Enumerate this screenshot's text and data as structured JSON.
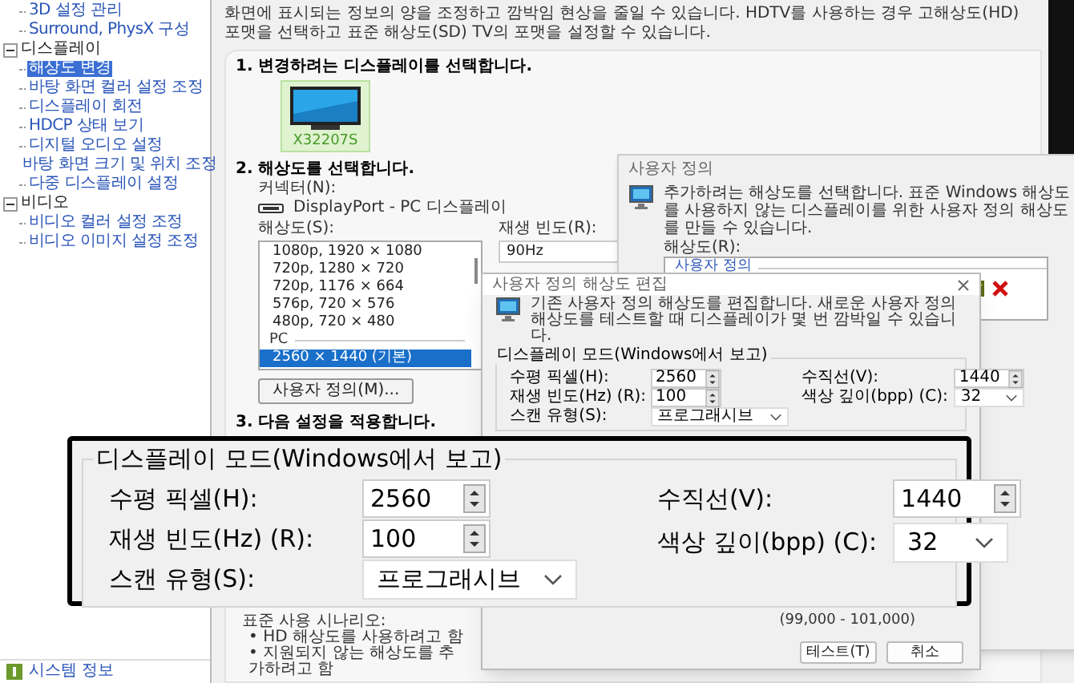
{
  "sidebar": {
    "groups": [
      {
        "children": [
          {
            "label": "3D 설정 관리",
            "selected": false
          },
          {
            "label": "Surround, PhysX 구성",
            "selected": false
          }
        ]
      },
      {
        "label": "디스플레이",
        "expanded": true,
        "children": [
          {
            "label": "해상도 변경",
            "selected": true
          },
          {
            "label": "바탕 화면 컬러 설정 조정",
            "selected": false
          },
          {
            "label": "디스플레이 회전",
            "selected": false
          },
          {
            "label": "HDCP 상태 보기",
            "selected": false
          },
          {
            "label": "디지털 오디오 설정",
            "selected": false
          },
          {
            "label": "바탕 화면 크기 및 위치 조정",
            "selected": false
          },
          {
            "label": "다중 디스플레이 설정",
            "selected": false
          }
        ]
      },
      {
        "label": "비디오",
        "expanded": true,
        "children": [
          {
            "label": "비디오 컬러 설정 조정",
            "selected": false
          },
          {
            "label": "비디오 이미지 설정 조정",
            "selected": false
          }
        ]
      }
    ],
    "footer": "시스템 정보"
  },
  "main": {
    "description": "화면에 표시되는 정보의 양을 조정하고 깜박임 현상을 줄일 수 있습니다. HDTV를 사용하는 경우 고해상도(HD) 포맷을 선택하고 표준 해상도(SD) TV의 포맷을 설정할 수 있습니다.",
    "step1": {
      "title": "1. 변경하려는 디스플레이를 선택합니다.",
      "displays": [
        {
          "name": "X32207S",
          "selected": true
        }
      ]
    },
    "step2": {
      "title": "2. 해상도를 선택합니다.",
      "connector_label": "커넥터(N):",
      "connector": "DisplayPort - PC 디스플레이",
      "resolution_label": "해상도(S):",
      "resolutions": [
        {
          "kind": "item",
          "label": "1080p, 1920 × 1080",
          "selected": false
        },
        {
          "kind": "item",
          "label": "720p, 1280 × 720",
          "selected": false
        },
        {
          "kind": "item",
          "label": "720p, 1176 × 664",
          "selected": false
        },
        {
          "kind": "item",
          "label": "576p, 720 × 576",
          "selected": false
        },
        {
          "kind": "item",
          "label": "480p, 720 × 480",
          "selected": false
        },
        {
          "kind": "group",
          "label": "PC",
          "selected": false
        },
        {
          "kind": "item",
          "label": "2560 × 1440 (기본)",
          "selected": true
        }
      ],
      "refresh_label": "재생 빈도(R):",
      "refresh_rate": "90Hz",
      "custom_button": "사용자 정의(M)..."
    },
    "step3": {
      "title": "3. 다음 설정을 적용합니다."
    },
    "scenarios": {
      "title": "표준 사용 시나리오:",
      "items": [
        "• HD 해상도를 사용하려고 함",
        "• 지원되지 않는 해상도를 추가하려고 함"
      ]
    }
  },
  "custom_dialog": {
    "title": "사용자 정의",
    "info": "추가하려는 해상도를 선택합니다. 표준 Windows 해상도를 사용하지 않는 디스플레이를 위한 사용자 정의 해상도를 만들 수 있습니다.",
    "resolution_label": "해상도(R):",
    "list_group": "사용자 정의"
  },
  "edit_dialog": {
    "title": "사용자 정의 해상도 편집",
    "info": "기존 사용자 정의 해상도를 편집합니다. 새로운 사용자 정의 해상도를 테스트할 때 디스플레이가 몇 번 깜박일 수 있습니다.",
    "group_title": "디스플레이 모드(Windows에서 보고)",
    "left_fields": [
      {
        "label": "수평 픽셀(H):",
        "value": "2560",
        "kind": "spin"
      },
      {
        "label": "재생 빈도(Hz) (R):",
        "value": "100",
        "kind": "spin"
      },
      {
        "label": "스캔 유형(S):",
        "value": "프로그래시브",
        "kind": "dropdown"
      }
    ],
    "right_fields": [
      {
        "label": "수직선(V):",
        "value": "1440",
        "kind": "spin"
      },
      {
        "label": "색상 깊이(bpp) (C):",
        "value": "32",
        "kind": "dropdown"
      }
    ],
    "range": "(99,000 - 101,000)",
    "buttons": [
      "테스트(T)",
      "취소"
    ]
  },
  "callout": {
    "group_title": "디스플레이 모드(Windows에서 보고)",
    "left_fields": [
      {
        "label": "수평 픽셀(H):",
        "value": "2560",
        "kind": "spin"
      },
      {
        "label": "재생 빈도(Hz) (R):",
        "value": "100",
        "kind": "spin"
      },
      {
        "label": "스캔 유형(S):",
        "value": "프로그래시브",
        "kind": "dropdown"
      }
    ],
    "right_fields": [
      {
        "label": "수직선(V):",
        "value": "1440",
        "kind": "spin"
      },
      {
        "label": "색상 깊이(bpp) (C):",
        "value": "32",
        "kind": "dropdown"
      }
    ]
  }
}
